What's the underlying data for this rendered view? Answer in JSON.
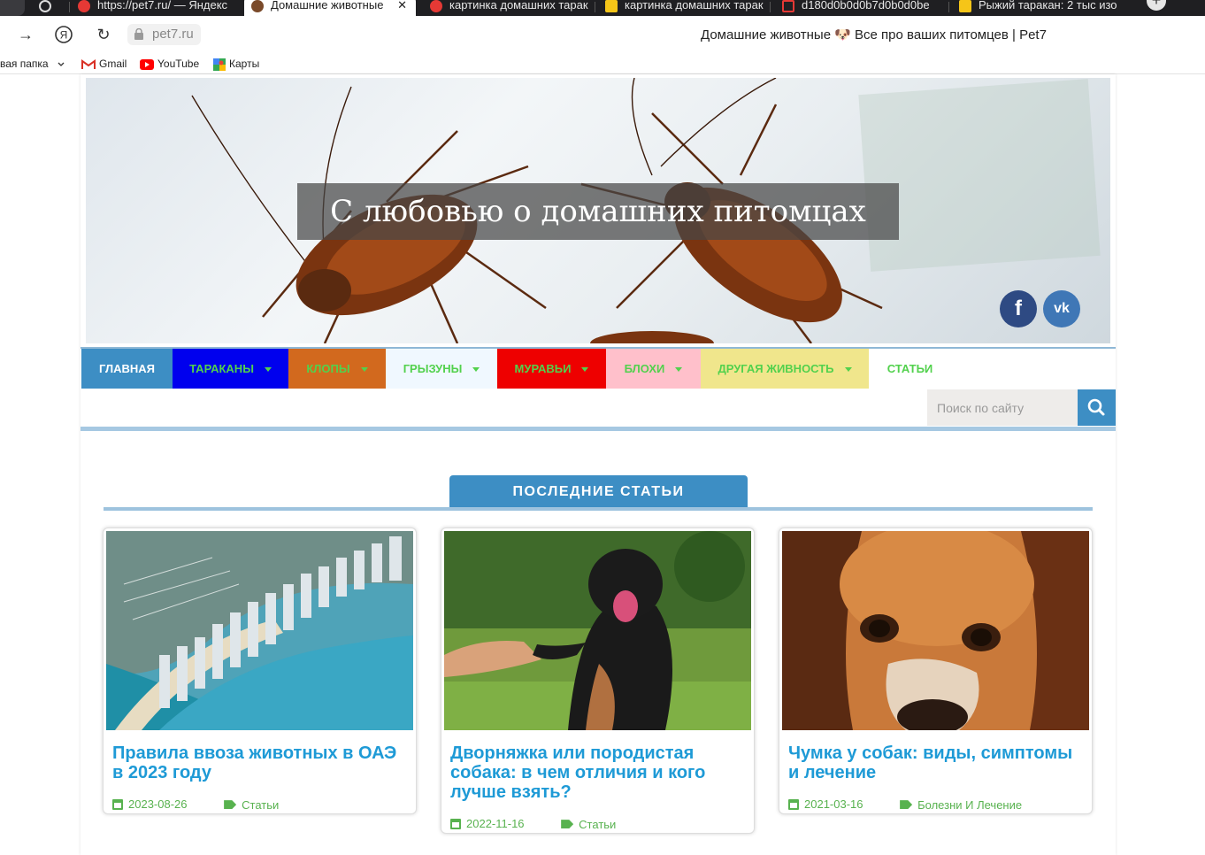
{
  "browser": {
    "tabs": [
      {
        "label": "",
        "icon": "openai-icon"
      },
      {
        "label": "https://pet7.ru/ — Яндекс",
        "icon": "yandex-icon"
      },
      {
        "label": "Домашние животные",
        "icon": "dog-icon",
        "active": true
      },
      {
        "label": "картинка домашних тарак",
        "icon": "yandex-icon"
      },
      {
        "label": "картинка домашних тарак",
        "icon": "crown-icon"
      },
      {
        "label": "d180d0b0d0b7d0b0d0be",
        "icon": "bookmark-icon"
      },
      {
        "label": "Рыжий таракан: 2 тыс изо",
        "icon": "crown-icon"
      }
    ],
    "new_tab_label": "+",
    "address": "pet7.ru",
    "page_title": "Домашние животные 🐶 Все про ваших питомцев | Pet7",
    "bookmarks": [
      {
        "label": "вая папка",
        "icon": "chevron-down-icon"
      },
      {
        "label": "Gmail",
        "icon": "gmail-icon"
      },
      {
        "label": "YouTube",
        "icon": "youtube-icon"
      },
      {
        "label": "Карты",
        "icon": "maps-icon"
      }
    ]
  },
  "site": {
    "banner_title": "С любовью о домашних питомцах",
    "social": [
      {
        "label": "f",
        "icon": "facebook-icon"
      },
      {
        "label": "vk",
        "icon": "vk-icon"
      }
    ],
    "menu": [
      {
        "label": "Главная",
        "bg": "#3d8ec4",
        "color": "#ffffff",
        "has_dropdown": false
      },
      {
        "label": "Тараканы",
        "bg": "#0000ee",
        "color": "#52d14d",
        "has_dropdown": true
      },
      {
        "label": "Клопы",
        "bg": "#d2691e",
        "color": "#52d14d",
        "has_dropdown": true
      },
      {
        "label": "Грызуны",
        "bg": "#f0f8ff",
        "color": "#52d14d",
        "has_dropdown": true
      },
      {
        "label": "Муравьи",
        "bg": "#ee0000",
        "color": "#52d14d",
        "has_dropdown": true
      },
      {
        "label": "Блохи",
        "bg": "#ffc0cb",
        "color": "#52d14d",
        "has_dropdown": true
      },
      {
        "label": "Другая живность",
        "bg": "#f0e68c",
        "color": "#52d14d",
        "has_dropdown": true
      },
      {
        "label": "Статьи",
        "bg": "#ffffff",
        "color": "#52d14d",
        "has_dropdown": false
      }
    ],
    "search": {
      "placeholder": "Поиск по сайту",
      "icon": "search-icon"
    },
    "section_heading": "ПОСЛЕДНИЕ СТАТЬИ",
    "articles": [
      {
        "title": "Правила ввоза животных в ОАЭ в 2023 году",
        "date": "2023-08-26",
        "category": "Статьи",
        "image": "city-coast-aerial"
      },
      {
        "title": "Дворняжка или породистая собака: в чем отличия и кого лучше взять?",
        "date": "2022-11-16",
        "category": "Статьи",
        "image": "black-dog-paw"
      },
      {
        "title": "Чумка у собак: виды, симптомы и лечение",
        "date": "2021-03-16",
        "category": "Болезни И Лечение",
        "image": "sad-beagle"
      }
    ]
  },
  "colors": {
    "accent": "#3d8ec4",
    "link": "#1e9ad6",
    "meta": "#58b24f"
  }
}
